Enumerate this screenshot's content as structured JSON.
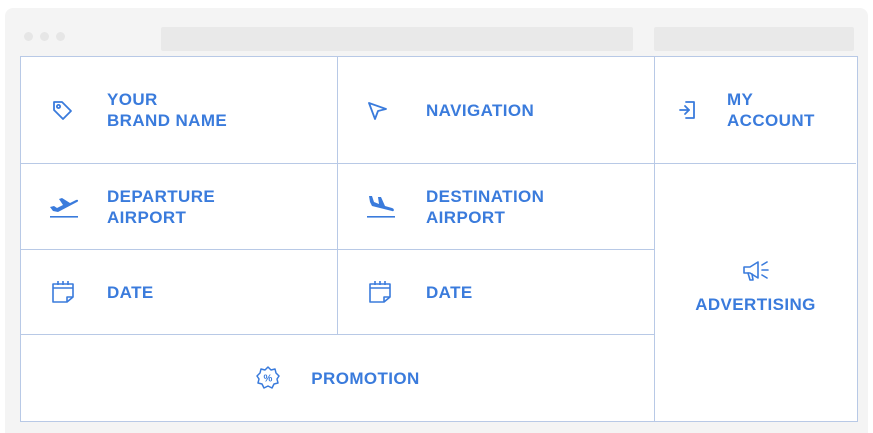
{
  "cells": {
    "brand": "YOUR\nBRAND NAME",
    "navigation": "NAVIGATION",
    "account": "MY\nACCOUNT",
    "departure": "DEPARTURE\nAIRPORT",
    "destination": "DESTINATION\nAIRPORT",
    "date_left": "DATE",
    "date_right": "DATE",
    "advertising": "ADVERTISING",
    "promotion": "PROMOTION"
  },
  "colors": {
    "accent": "#3a7bdc",
    "border": "#b8c9e6",
    "chrome": "#f4f4f4"
  },
  "icons": {
    "brand": "tag-icon",
    "navigation": "cursor-arrow-icon",
    "account": "sign-in-icon",
    "departure": "plane-takeoff-icon",
    "destination": "plane-landing-icon",
    "date": "calendar-icon",
    "advertising": "megaphone-icon",
    "promotion": "discount-badge-icon"
  }
}
